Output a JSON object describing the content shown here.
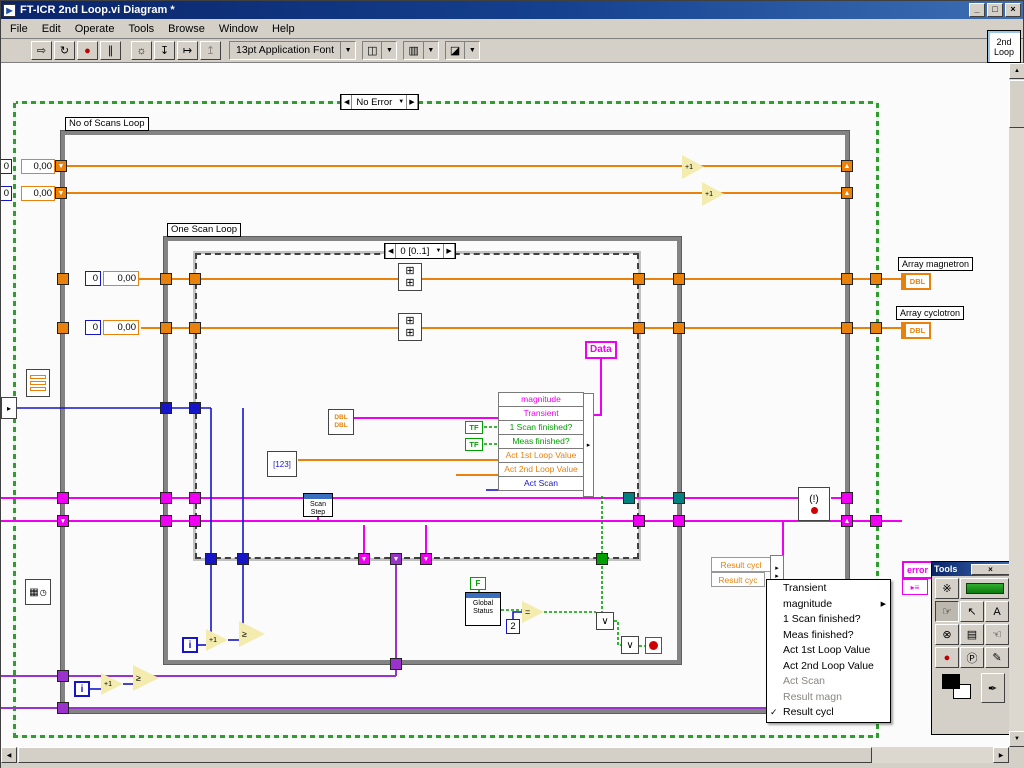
{
  "window": {
    "title": "FT-ICR 2nd Loop.vi Diagram *"
  },
  "menubar": {
    "items": [
      "File",
      "Edit",
      "Operate",
      "Tools",
      "Browse",
      "Window",
      "Help"
    ]
  },
  "toolbar": {
    "font_selector": "13pt Application Font"
  },
  "icons": {
    "run": "⇨",
    "run_continuous": "↻",
    "abort": "●",
    "pause": "∥",
    "highlight": "☼",
    "step_into": "↧",
    "step_over": "↦",
    "step_out": "↥",
    "dropdown": "▼",
    "align": "◫",
    "distribute": "▥",
    "reorder": "◪",
    "left": "◀",
    "right": "▶",
    "up": "▲",
    "down": "▼",
    "minimize": "_",
    "restore": "□",
    "close": "×",
    "app": "▶"
  },
  "corner_icon": {
    "line1": "2nd",
    "line2": "Loop"
  },
  "colors": {
    "wire_orange": "#e8820c",
    "wire_magenta": "#f000f0",
    "wire_blue": "#1616c8",
    "wire_green": "#00a000",
    "wire_violet": "#9933cc",
    "case_green": "#2f9e2f"
  },
  "diagram": {
    "case_structure": {
      "selector": "No Error"
    },
    "sequence": {
      "selector": "0 [0..1]"
    },
    "loops": {
      "outer_label": "No of Scans Loop",
      "inner_label": "One Scan Loop"
    },
    "constants": {
      "dbl": "0,00",
      "int0": "0",
      "int2": "2",
      "cut": "0"
    },
    "glyphs": {
      "i": "i",
      "incr": "+1",
      "geq": "≥",
      "or": "∨",
      "eq": "=",
      "excl": "(!)",
      "f": "F",
      "tf": "TF",
      "dbl": "DBL",
      "idx": "[123]",
      "grid": "⊞",
      "arrow": "▸",
      "clock": "◷",
      "table": "▦",
      "bars": "≡",
      "err_icon": "▸≡"
    },
    "nodes": {
      "scan_step": "Scan Step",
      "global_status": "Global Status",
      "data": "Data",
      "error": "error",
      "result_cycl_1": "Result cycl",
      "result_cycl_2": "Result cyc"
    },
    "indicators": {
      "array_magnetron": "Array magnetron",
      "array_cyclotron": "Array cyclotron"
    },
    "unbundle": {
      "rows": [
        {
          "label": "magnitude",
          "color": "#f000f0"
        },
        {
          "label": "Transient",
          "color": "#f000f0"
        },
        {
          "label": "1 Scan finished?",
          "color": "#00a000"
        },
        {
          "label": "Meas finished?",
          "color": "#00a000"
        },
        {
          "label": "Act 1st Loop Value",
          "color": "#e8820c"
        },
        {
          "label": "Act 2nd Loop Value",
          "color": "#e8820c"
        },
        {
          "label": "Act Scan",
          "color": "#1616c8"
        }
      ]
    },
    "context_menu": {
      "check": "✓",
      "submenu_arrow": "▶",
      "items": [
        {
          "label": "Transient"
        },
        {
          "label": "magnitude",
          "submenu": true
        },
        {
          "label": "1 Scan finished?"
        },
        {
          "label": "Meas finished?"
        },
        {
          "label": "Act 1st Loop Value"
        },
        {
          "label": "Act 2nd Loop Value"
        },
        {
          "label": "Act Scan",
          "disabled": true
        },
        {
          "label": "Result magn",
          "disabled": true
        },
        {
          "label": "Result cycl",
          "checked": true
        }
      ]
    },
    "tools_palette": {
      "title": "Tools",
      "icons": {
        "auto": "※",
        "operate": "☞",
        "position": "↖",
        "text": "A",
        "wire": "⊗",
        "menu": "▤",
        "scroll": "☜",
        "breakpoint": "●",
        "probe": "Ⓟ",
        "copy_color": "✎",
        "brush": "✒"
      }
    }
  }
}
